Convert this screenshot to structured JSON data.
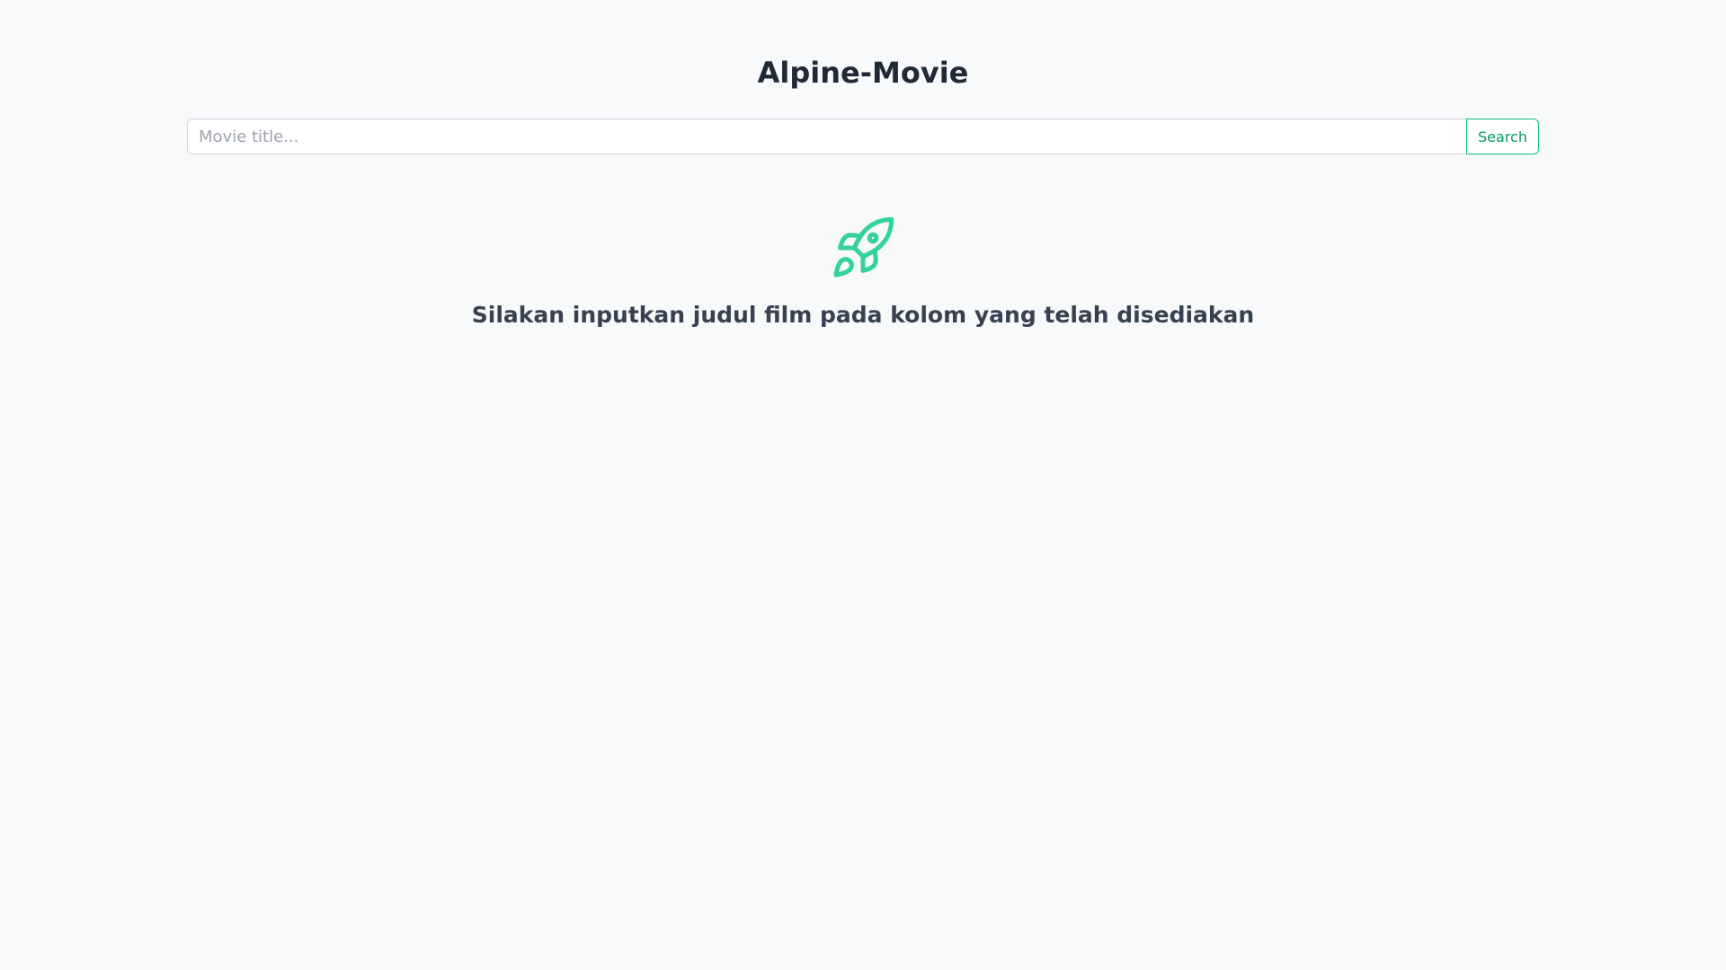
{
  "app": {
    "title": "Alpine-Movie"
  },
  "search": {
    "placeholder": "Movie title...",
    "value": "",
    "button_label": "Search"
  },
  "empty_state": {
    "icon": "rocket-icon",
    "message": "Silakan inputkan judul film pada kolom yang telah disediakan"
  },
  "colors": {
    "accent": "#10b981",
    "background": "#f8f9fb",
    "title_text": "#1f2937",
    "body_text": "#374151"
  }
}
